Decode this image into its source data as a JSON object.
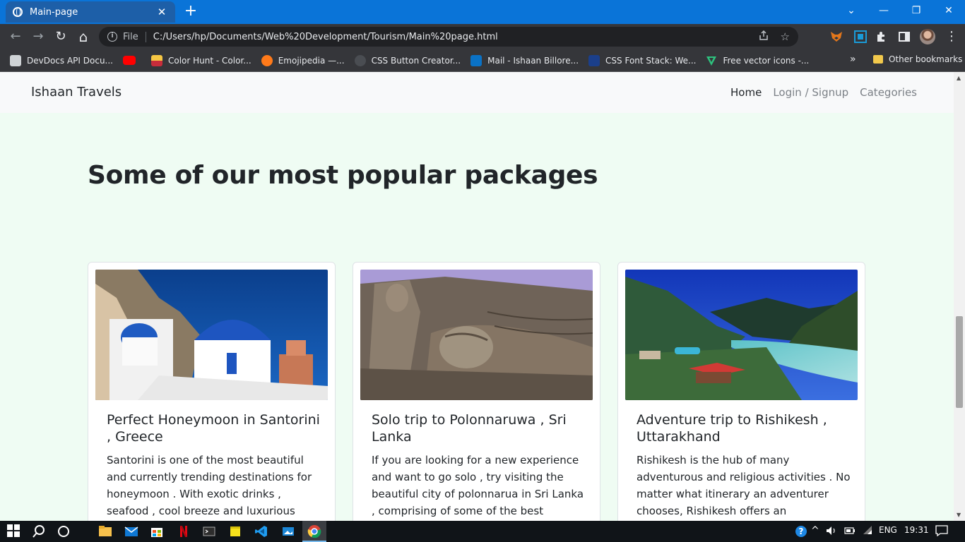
{
  "browser": {
    "tab": {
      "title": "Main-page",
      "close": "✕"
    },
    "new_tab": "+",
    "window_controls": {
      "chevron": "⌄",
      "minimize": "—",
      "restore": "❐",
      "close": "✕"
    },
    "nav": {
      "back": "←",
      "forward": "→",
      "reload": "↻",
      "home": "⌂"
    },
    "address": {
      "scheme": "File",
      "url": "C:/Users/hp/Documents/Web%20Development/Tourism/Main%20page.html",
      "share_icon": "share-icon",
      "bookmark_star": "☆"
    },
    "extensions": [
      "metamask-icon",
      "screen-capture-icon",
      "puzzle-icon",
      "side-panel-icon"
    ],
    "menu": "⋮",
    "bookmarks": [
      {
        "label": "DevDocs API Docu...",
        "icon": "devdocs-icon",
        "color": "#cfd3d6"
      },
      {
        "label": "",
        "icon": "youtube-icon",
        "color": "#ff0000"
      },
      {
        "label": "Color Hunt - Color...",
        "icon": "colorhunt-icon",
        "color": "#f6c744"
      },
      {
        "label": "Emojipedia —...",
        "icon": "emojipedia-icon",
        "color": "#ff7a1a"
      },
      {
        "label": "CSS Button Creator...",
        "icon": "css-button-icon",
        "color": "#5f6368"
      },
      {
        "label": "Mail - Ishaan Billore...",
        "icon": "outlook-icon",
        "color": "#0a72c6"
      },
      {
        "label": "CSS Font Stack: We...",
        "icon": "cssfontstack-icon",
        "color": "#1b3f8b"
      },
      {
        "label": "Free vector icons -...",
        "icon": "vector-icon",
        "color": "#2ec27e"
      }
    ],
    "bookmarks_more": "»",
    "other_bookmarks": "Other bookmarks"
  },
  "site": {
    "brand": "Ishaan Travels",
    "nav": [
      {
        "label": "Home",
        "active": true
      },
      {
        "label": "Login / Signup",
        "active": false
      },
      {
        "label": "Categories",
        "active": false
      }
    ],
    "heading": "Some of our most popular packages",
    "cards": [
      {
        "title": "Perfect Honeymoon in Santorini , Greece",
        "text": "Santorini is one of the most beautiful and currently trending destinations for honeymoon . With exotic drinks , seafood , cool breeze and luxurious hotels , create",
        "image": "santorini-image"
      },
      {
        "title": "Solo trip to Polonnaruwa , Sri Lanka",
        "text": "If you are looking for a new experience and want to go solo , try visiting the beautiful city of polonnarua in Sri Lanka , comprising of some of the best",
        "image": "polonnaruwa-image"
      },
      {
        "title": "Adventure trip to Rishikesh , Uttarakhand",
        "text": "Rishikesh is the hub of many adventurous and religious activities . No matter what itinerary an adventurer chooses, Rishikesh offers an",
        "image": "rishikesh-image"
      }
    ]
  },
  "taskbar": {
    "apps": [
      "windows-start-icon",
      "search-icon",
      "cortana-icon",
      "file-explorer-icon",
      "mail-icon",
      "store-icon",
      "netflix-icon",
      "terminal-icon",
      "sticky-notes-icon",
      "vscode-icon",
      "photos-icon",
      "chrome-icon"
    ],
    "tray": {
      "help": "?",
      "caret": "^",
      "volume": "🔊",
      "language": "ENG",
      "time": "19:31"
    }
  }
}
